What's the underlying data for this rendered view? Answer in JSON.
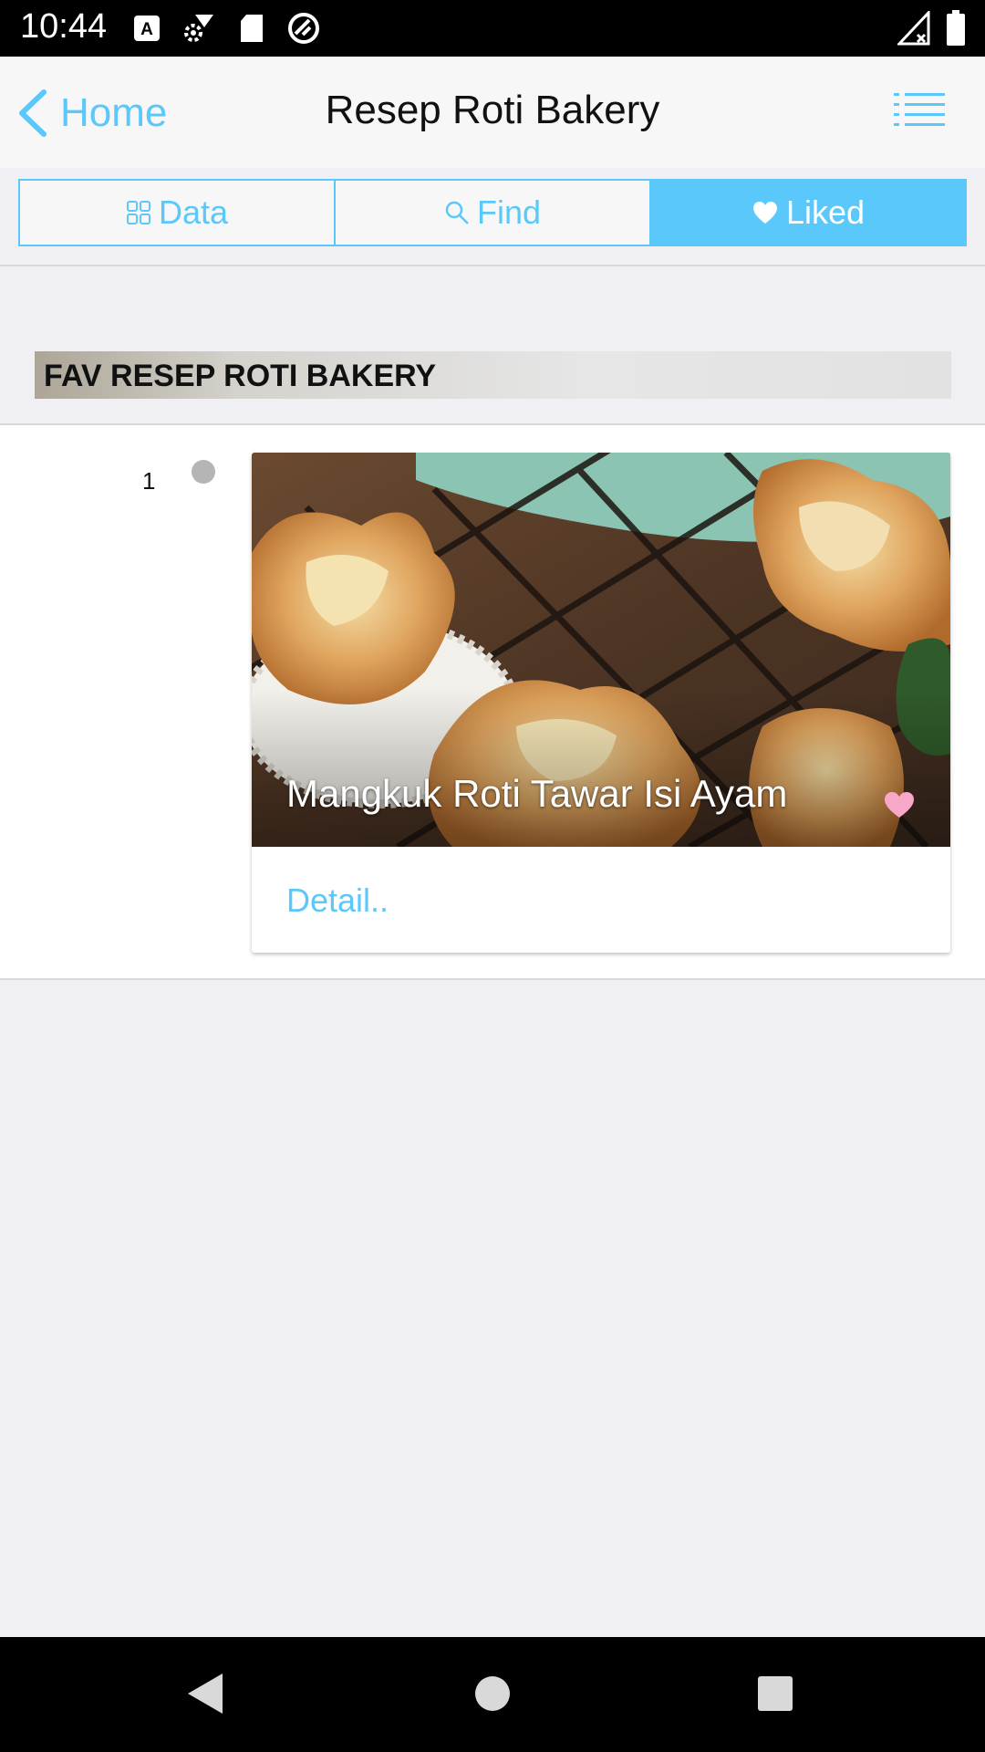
{
  "status_bar": {
    "time": "10:44",
    "icons": [
      "keyboard-a-icon",
      "wifi-settings-icon",
      "sd-card-icon",
      "sync-icon",
      "signal-off-icon",
      "battery-icon"
    ]
  },
  "nav_bar": {
    "back_label": "Home",
    "title": "Resep Roti Bakery",
    "menu_icon": "list-menu-icon"
  },
  "tabs": [
    {
      "label": "Data",
      "icon": "grid-icon",
      "active": false
    },
    {
      "label": "Find",
      "icon": "search-icon",
      "active": false
    },
    {
      "label": "Liked",
      "icon": "heart-icon",
      "active": true
    }
  ],
  "section": {
    "title": "FAV RESEP ROTI BAKERY"
  },
  "items": [
    {
      "number": "1",
      "title": "Mangkuk Roti Tawar Isi Ayam",
      "link_label": "Detail.."
    }
  ],
  "colors": {
    "accent": "#5ac8fa",
    "heart": "#f7a8c8",
    "background": "#efeff4"
  },
  "system_nav": [
    "back-icon",
    "home-icon",
    "recents-icon"
  ]
}
